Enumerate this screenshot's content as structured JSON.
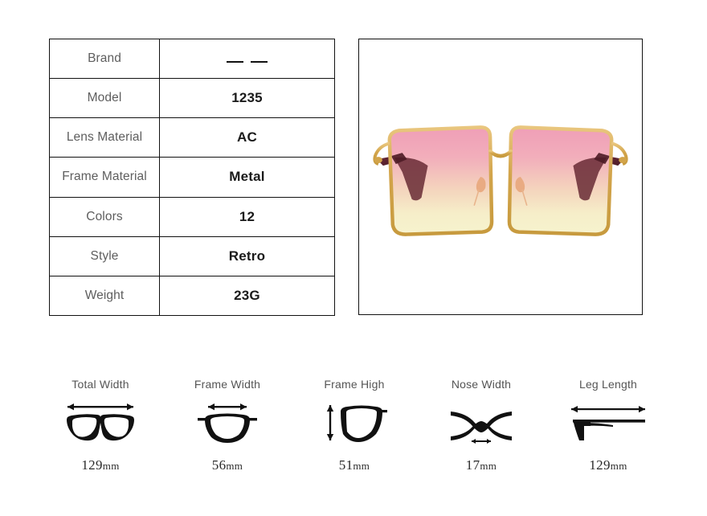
{
  "spec_table": {
    "rows": [
      {
        "label": "Brand",
        "value": "— —",
        "is_dashes": true
      },
      {
        "label": "Model",
        "value": "1235",
        "is_dashes": false
      },
      {
        "label": "Lens Material",
        "value": "AC",
        "is_dashes": false
      },
      {
        "label": "Frame Material",
        "value": "Metal",
        "is_dashes": false
      },
      {
        "label": "Colors",
        "value": "12",
        "is_dashes": false
      },
      {
        "label": "Style",
        "value": "Retro",
        "is_dashes": false
      },
      {
        "label": "Weight",
        "value": "23G",
        "is_dashes": false
      }
    ]
  },
  "product_photo": {
    "alt": "oversized square gold-frame sunglasses with pink to yellow gradient lenses",
    "frame_color": "#d9a441",
    "frame_highlight": "#f0cf8a",
    "lens_top_color": "#f0a0b8",
    "lens_mid_color": "#f3c3b8",
    "lens_bottom_color": "#f6f2c9",
    "temple_color": "#5c2230",
    "background": "#ffffff"
  },
  "measurements": [
    {
      "label": "Total Width",
      "number": "129",
      "unit": "mm",
      "icon": "glasses-full-icon"
    },
    {
      "label": "Frame Width",
      "number": "56",
      "unit": "mm",
      "icon": "lens-rim-width-icon"
    },
    {
      "label": "Frame High",
      "number": "51",
      "unit": "mm",
      "icon": "lens-rim-height-icon"
    },
    {
      "label": "Nose Width",
      "number": "17",
      "unit": "mm",
      "icon": "nose-bridge-icon"
    },
    {
      "label": "Leg Length",
      "number": "129",
      "unit": "mm",
      "icon": "temple-arm-icon"
    }
  ]
}
